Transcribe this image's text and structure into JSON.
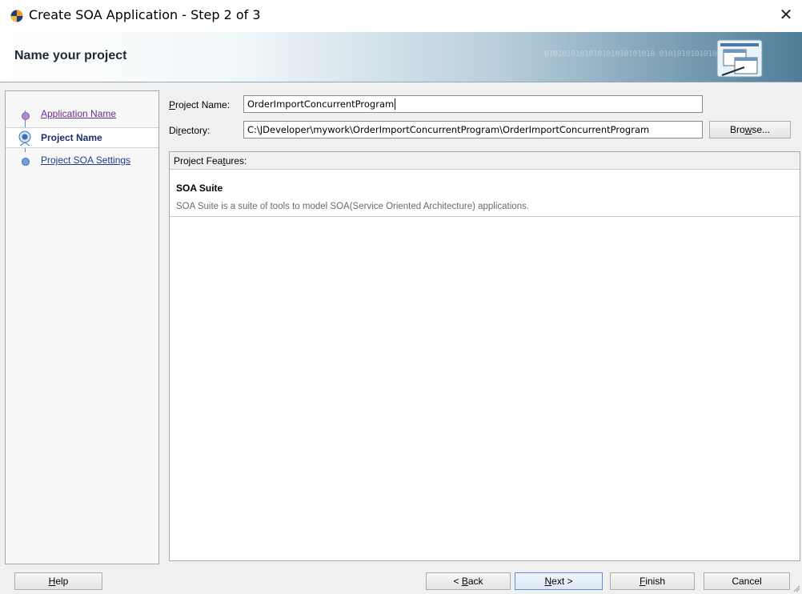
{
  "window": {
    "title": "Create SOA Application - Step 2 of 3",
    "close_symbol": "✕"
  },
  "header": {
    "title": "Name your project",
    "decor_binary": "0101010101010101010101010 0101010101010"
  },
  "nav": {
    "items": [
      {
        "label": "Application Name"
      },
      {
        "label": "Project Name"
      },
      {
        "label": "Project SOA Settings"
      }
    ]
  },
  "form": {
    "project_name": {
      "label_mnemonic": "P",
      "label_rest": "roject Name:",
      "value": "OrderImportConcurrentProgram"
    },
    "directory": {
      "label_pre": "Di",
      "label_mnemonic": "r",
      "label_rest": "ectory:",
      "value": "C:\\JDeveloper\\mywork\\OrderImportConcurrentProgram\\OrderImportConcurrentProgram"
    },
    "browse": {
      "pre": "Bro",
      "mnemonic": "w",
      "rest": "se..."
    }
  },
  "features": {
    "header": {
      "pre": "Project Fea",
      "mnemonic": "t",
      "rest": "ures:"
    },
    "items": [
      {
        "name": "SOA Suite",
        "description": "SOA Suite is a suite of tools to model SOA(Service Oriented Architecture) applications."
      }
    ]
  },
  "buttons": {
    "help": {
      "mnemonic": "H",
      "rest": "elp"
    },
    "back": {
      "pre": "< ",
      "mnemonic": "B",
      "rest": "ack"
    },
    "next": {
      "mnemonic": "N",
      "rest": "ext >"
    },
    "finish": {
      "mnemonic": "F",
      "rest": "inish"
    },
    "cancel": {
      "label": "Cancel"
    }
  }
}
